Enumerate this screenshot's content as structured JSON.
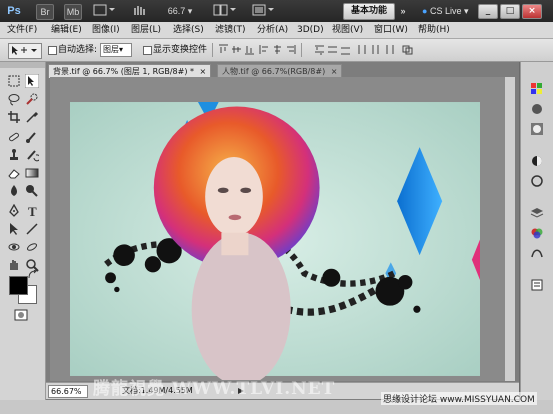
{
  "app": {
    "logo": "Ps",
    "launch_buttons": [
      "Br",
      "Mb"
    ],
    "zoom_level": "66.7",
    "workspace_label": "基本功能",
    "expand_label": "»",
    "cs_live_label": "CS Live",
    "window_controls": [
      "_",
      "□",
      "×"
    ]
  },
  "menu": [
    "文件(F)",
    "编辑(E)",
    "图像(I)",
    "图层(L)",
    "选择(S)",
    "滤镜(T)",
    "分析(A)",
    "3D(D)",
    "视图(V)",
    "窗口(W)",
    "帮助(H)"
  ],
  "options": {
    "auto_select_label": "自动选择:",
    "auto_select_value": "图层",
    "show_transform_label": "显示变换控件"
  },
  "tabs": [
    {
      "label": "背景.tif @ 66.7% (图层 1, RGB/8#) *",
      "close": "×"
    },
    {
      "label": "人物.tif @ 66.7%(RGB/8#)",
      "close": "×"
    }
  ],
  "status": {
    "zoom": "66.67%",
    "doc_info": "文档:1.49M/4.55M"
  },
  "watermark": "腾龍視覺 WWW.TLVI.NET",
  "credit": "思缘设计论坛 www.MISSYUAN.COM",
  "colors": {
    "accent_blue": "#1e8fe0",
    "pink": "#e0307a",
    "bg_mint": "#bfe0d6"
  }
}
